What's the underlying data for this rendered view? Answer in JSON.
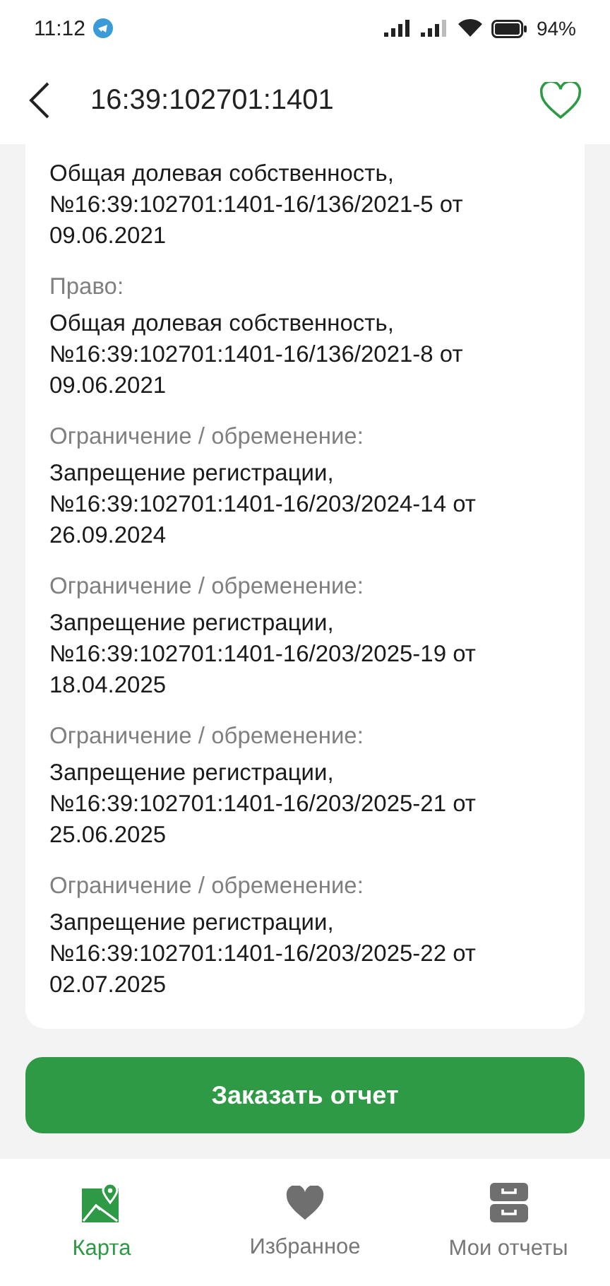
{
  "status_bar": {
    "time": "11:12",
    "battery": "94%"
  },
  "header": {
    "title": "16:39:102701:1401"
  },
  "entries": [
    {
      "value": "Общая долевая собственность, №16:39:102701:1401-16/136/2021-5 от 09.06.2021"
    },
    {
      "label": "Право:",
      "value": "Общая долевая собственность, №16:39:102701:1401-16/136/2021-8 от 09.06.2021"
    },
    {
      "label": "Ограничение / обременение:",
      "value": "Запрещение регистрации, №16:39:102701:1401-16/203/2024-14 от 26.09.2024"
    },
    {
      "label": "Ограничение / обременение:",
      "value": "Запрещение регистрации, №16:39:102701:1401-16/203/2025-19 от 18.04.2025"
    },
    {
      "label": "Ограничение / обременение:",
      "value": "Запрещение регистрации, №16:39:102701:1401-16/203/2025-21 от 25.06.2025"
    },
    {
      "label": "Ограничение / обременение:",
      "value": "Запрещение регистрации, №16:39:102701:1401-16/203/2025-22 от 02.07.2025"
    }
  ],
  "order_button": "Заказать отчет",
  "bottom_nav": [
    {
      "kind": "map",
      "label": "Карта",
      "selected": true
    },
    {
      "kind": "favorites",
      "label": "Избранное",
      "selected": false
    },
    {
      "kind": "reports",
      "label": "Мои отчеты",
      "selected": false
    }
  ]
}
